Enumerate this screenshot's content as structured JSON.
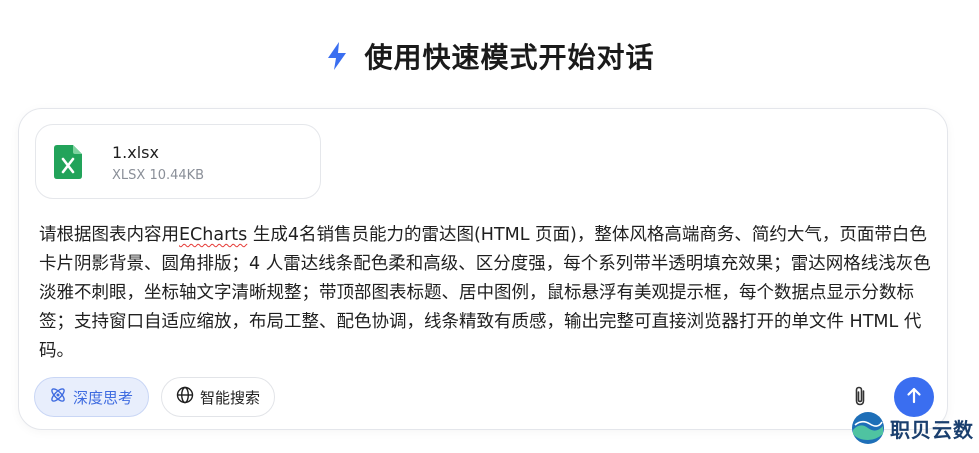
{
  "header": {
    "title": "使用快速模式开始对话",
    "icon": "lightning-icon",
    "icon_color": "#3a6ef0"
  },
  "attachment": {
    "file_name": "1.xlsx",
    "file_meta": "XLSX 10.44KB",
    "icon": "excel-file-icon",
    "icon_color": "#22a35a"
  },
  "prompt": {
    "before": "请根据图表内容用",
    "flagged_word": "ECharts",
    "after": " 生成4名销售员能力的雷达图(HTML 页面)，整体风格高端商务、简约大气，页面带白色卡片阴影背景、圆角排版；4 人雷达线条配色柔和高级、区分度强，每个系列带半透明填充效果；雷达网格线浅灰色淡雅不刺眼，坐标轴文字清晰规整；带顶部图表标题、居中图例，鼠标悬浮有美观提示框，每个数据点显示分数标签；支持窗口自适应缩放，布局工整、配色协调，线条精致有质感，输出完整可直接浏览器打开的单文件 HTML 代码。"
  },
  "toolbar": {
    "deep_think_label": "深度思考",
    "deep_think_icon": "atom-icon",
    "smart_search_label": "智能搜索",
    "smart_search_icon": "globe-icon",
    "attach_icon": "paperclip-icon",
    "send_icon": "arrow-up-icon",
    "accent_color": "#3a6ef0"
  },
  "watermark": {
    "text": "职贝云数"
  }
}
